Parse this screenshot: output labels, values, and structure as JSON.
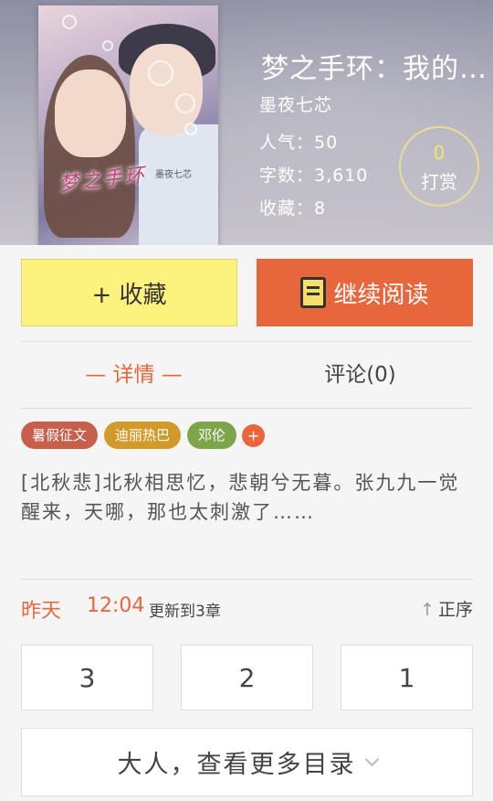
{
  "book": {
    "title": "梦之手环：我的…",
    "author": "墨夜七芯",
    "popularity_label": "人气：50",
    "word_count_label": "字数：3,610",
    "favorites_label": "收藏：8",
    "cover": {
      "title_art": "梦之手环",
      "author_art": "墨夜七芯"
    }
  },
  "tip": {
    "count": "0",
    "label": "打赏"
  },
  "actions": {
    "favorite_label": "+ 收藏",
    "read_label": "继续阅读"
  },
  "tabs": {
    "details": "— 详情 —",
    "comments": "评论(0)"
  },
  "tags": [
    {
      "label": "暑假征文",
      "color": "#c85f4c"
    },
    {
      "label": "迪丽热巴",
      "color": "#d19a2a"
    },
    {
      "label": "邓伦",
      "color": "#7fa54a"
    }
  ],
  "tag_add": "+",
  "synopsis": "[北秋悲]北秋相思忆，悲朝兮无暮。张九九一觉醒来，天哪，那也太刺激了……",
  "update": {
    "day": "昨天",
    "time": "12:04",
    "text": "更新到3章",
    "sort_label": "正序"
  },
  "chapters": [
    "3",
    "2",
    "1"
  ],
  "more_catalog": "大人，查看更多目录",
  "colors": {
    "accent": "#e8663c",
    "favorite_bg": "#fbf37d",
    "tip_count": "#f4e36d"
  }
}
